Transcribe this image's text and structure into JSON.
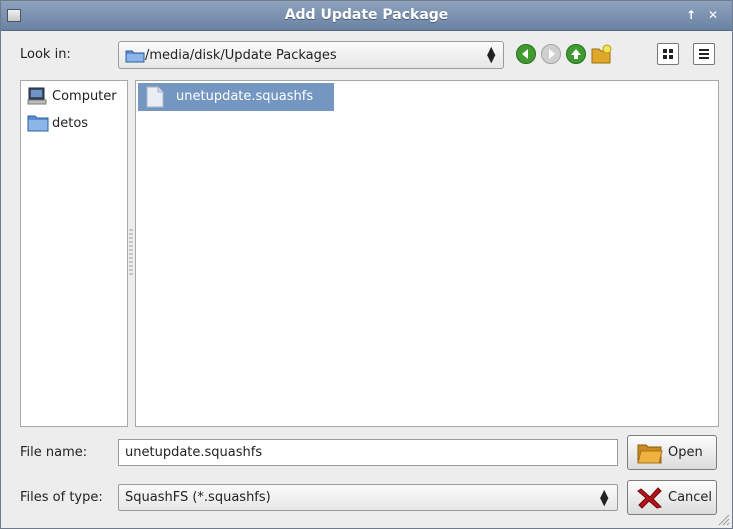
{
  "window": {
    "title": "Add Update Package"
  },
  "toolbar": {
    "look_in_label": "Look in:",
    "path": "/media/disk/Update Packages"
  },
  "sidebar": {
    "items": [
      {
        "label": "Computer",
        "icon": "computer-icon"
      },
      {
        "label": "detos",
        "icon": "folder-icon"
      }
    ]
  },
  "files": [
    {
      "name": "unetupdate.squashfs",
      "selected": true
    }
  ],
  "form": {
    "file_name_label": "File name:",
    "file_name_value": "unetupdate.squashfs",
    "files_of_type_label": "Files of type:",
    "files_of_type_value": "SquashFS (*.squashfs)"
  },
  "buttons": {
    "open": "Open",
    "cancel": "Cancel"
  },
  "colors": {
    "titlebar": "#7a90b0",
    "selection": "#7497c2",
    "nav_green": "#3f9a2f"
  }
}
